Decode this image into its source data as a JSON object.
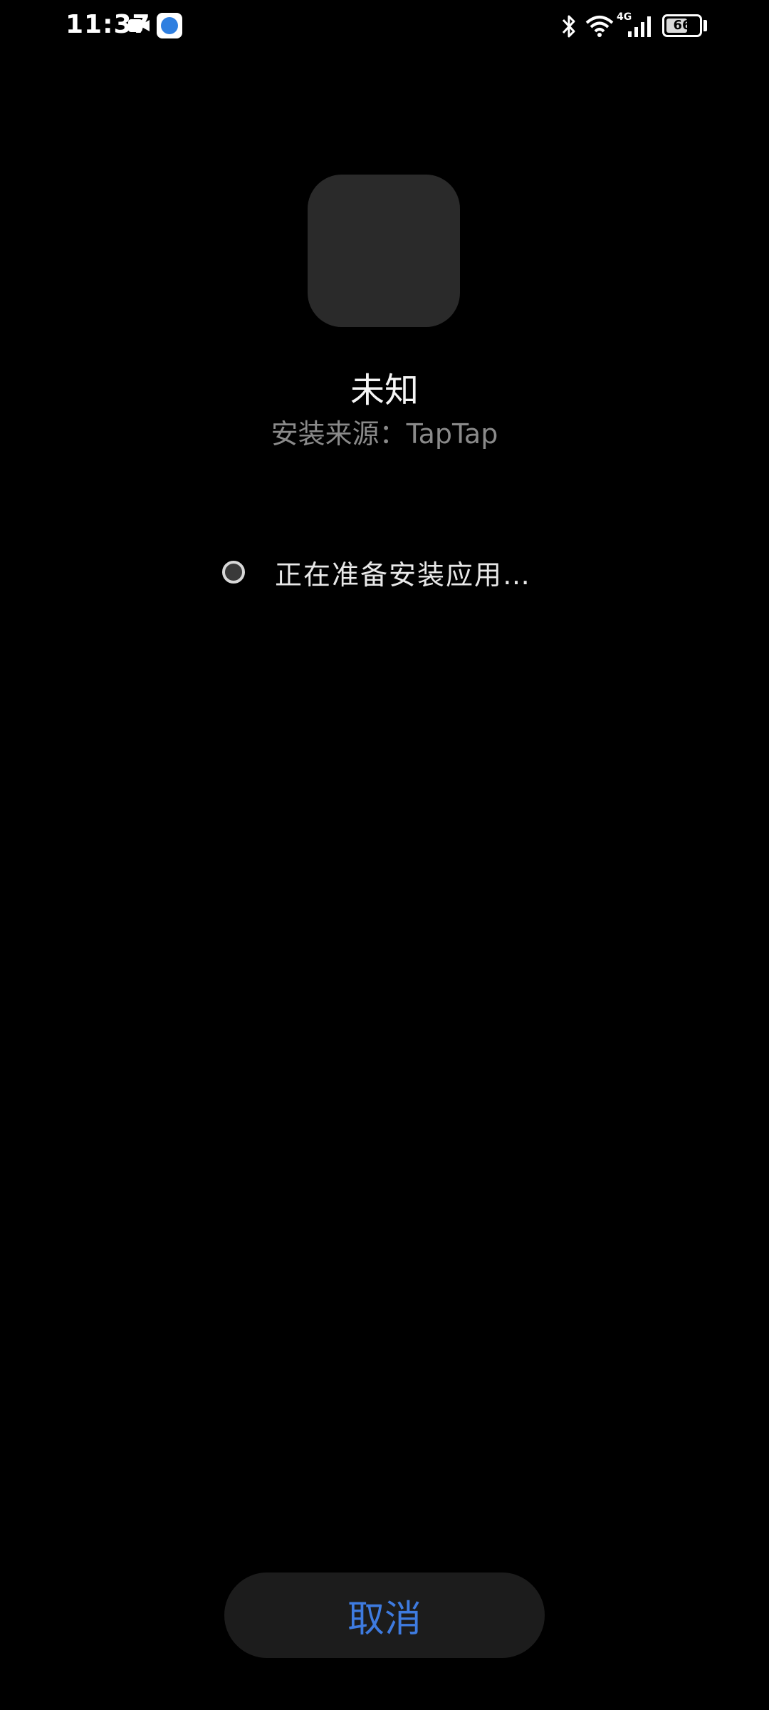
{
  "status_bar": {
    "time": "11:37",
    "network_type": "4G",
    "battery_level": "66",
    "battery_fraction": 0.66,
    "icons": [
      "video-camera-icon",
      "app-notification-icon",
      "bluetooth-icon",
      "wifi-icon",
      "cellular-signal-icon",
      "battery-icon"
    ]
  },
  "app": {
    "name": "未知",
    "install_source": "安装来源：TapTap"
  },
  "progress": {
    "message": "正在准备安装应用…"
  },
  "actions": {
    "cancel_label": "取消"
  },
  "colors": {
    "background": "#000000",
    "icon_placeholder": "#2a2a2a",
    "button_background": "#1c1c1c",
    "accent": "#3e7be0",
    "secondary_text": "#8a8a8a"
  }
}
